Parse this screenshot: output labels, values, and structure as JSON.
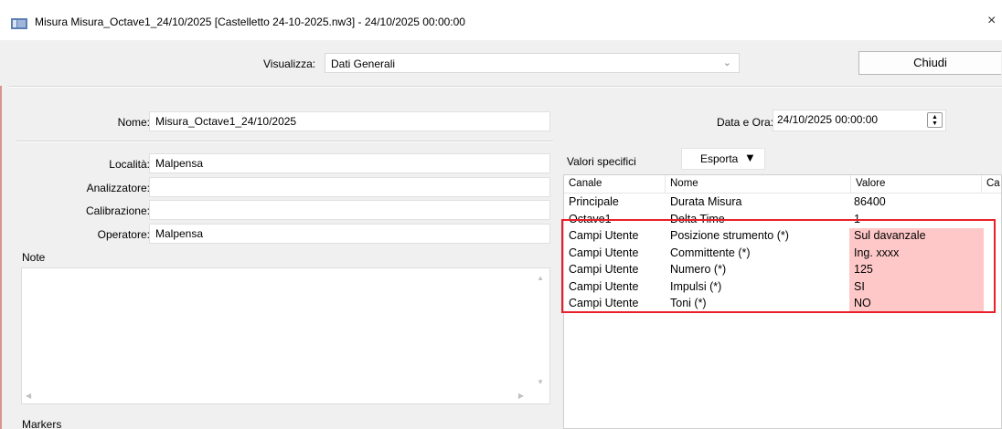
{
  "window": {
    "title": "Misura Misura_Octave1_24/10/2025 [Castelletto 24-10-2025.nw3] - 24/10/2025 00:00:00",
    "close_glyph": "×",
    "icon": "window-app-icon"
  },
  "toolbar": {
    "visualizza_label": "Visualizza:",
    "visualizza_value": "Dati Generali",
    "chiudi_label": "Chiudi"
  },
  "general": {
    "nome_label": "Nome:",
    "nome_value": "Misura_Octave1_24/10/2025",
    "dataora_label": "Data e Ora:",
    "dataora_value": "24/10/2025 00:00:00",
    "localita_label": "Località:",
    "localita_value": "Malpensa",
    "analizzatore_label": "Analizzatore:",
    "analizzatore_value": "",
    "calibrazione_label": "Calibrazione:",
    "calibrazione_value": "",
    "operatore_label": "Operatore:",
    "operatore_value": "Malpensa",
    "note_label": "Note",
    "note_value": "",
    "markers_label": "Markers"
  },
  "values_panel": {
    "label": "Valori specifici",
    "esporta_label": "Esporta",
    "columns": [
      "Canale",
      "Nome",
      "Valore",
      "Ca"
    ],
    "rows": [
      {
        "canale": "Principale",
        "nome": "Durata Misura",
        "valore": "86400",
        "user_field": false
      },
      {
        "canale": "Octave1",
        "nome": "Delta Time",
        "valore": "1",
        "user_field": false
      },
      {
        "canale": "Campi Utente",
        "nome": "Posizione strumento (*)",
        "valore": "Sul davanzale",
        "user_field": true
      },
      {
        "canale": "Campi Utente",
        "nome": "Committente (*)",
        "valore": "Ing. xxxx",
        "user_field": true
      },
      {
        "canale": "Campi Utente",
        "nome": "Numero (*)",
        "valore": "125",
        "user_field": true
      },
      {
        "canale": "Campi Utente",
        "nome": "Impulsi (*)",
        "valore": "SI",
        "user_field": true
      },
      {
        "canale": "Campi Utente",
        "nome": "Toni (*)",
        "valore": "NO",
        "user_field": true
      }
    ]
  },
  "colors": {
    "highlight_border": "#e8202a",
    "user_value_bg": "#ffc8c8"
  }
}
